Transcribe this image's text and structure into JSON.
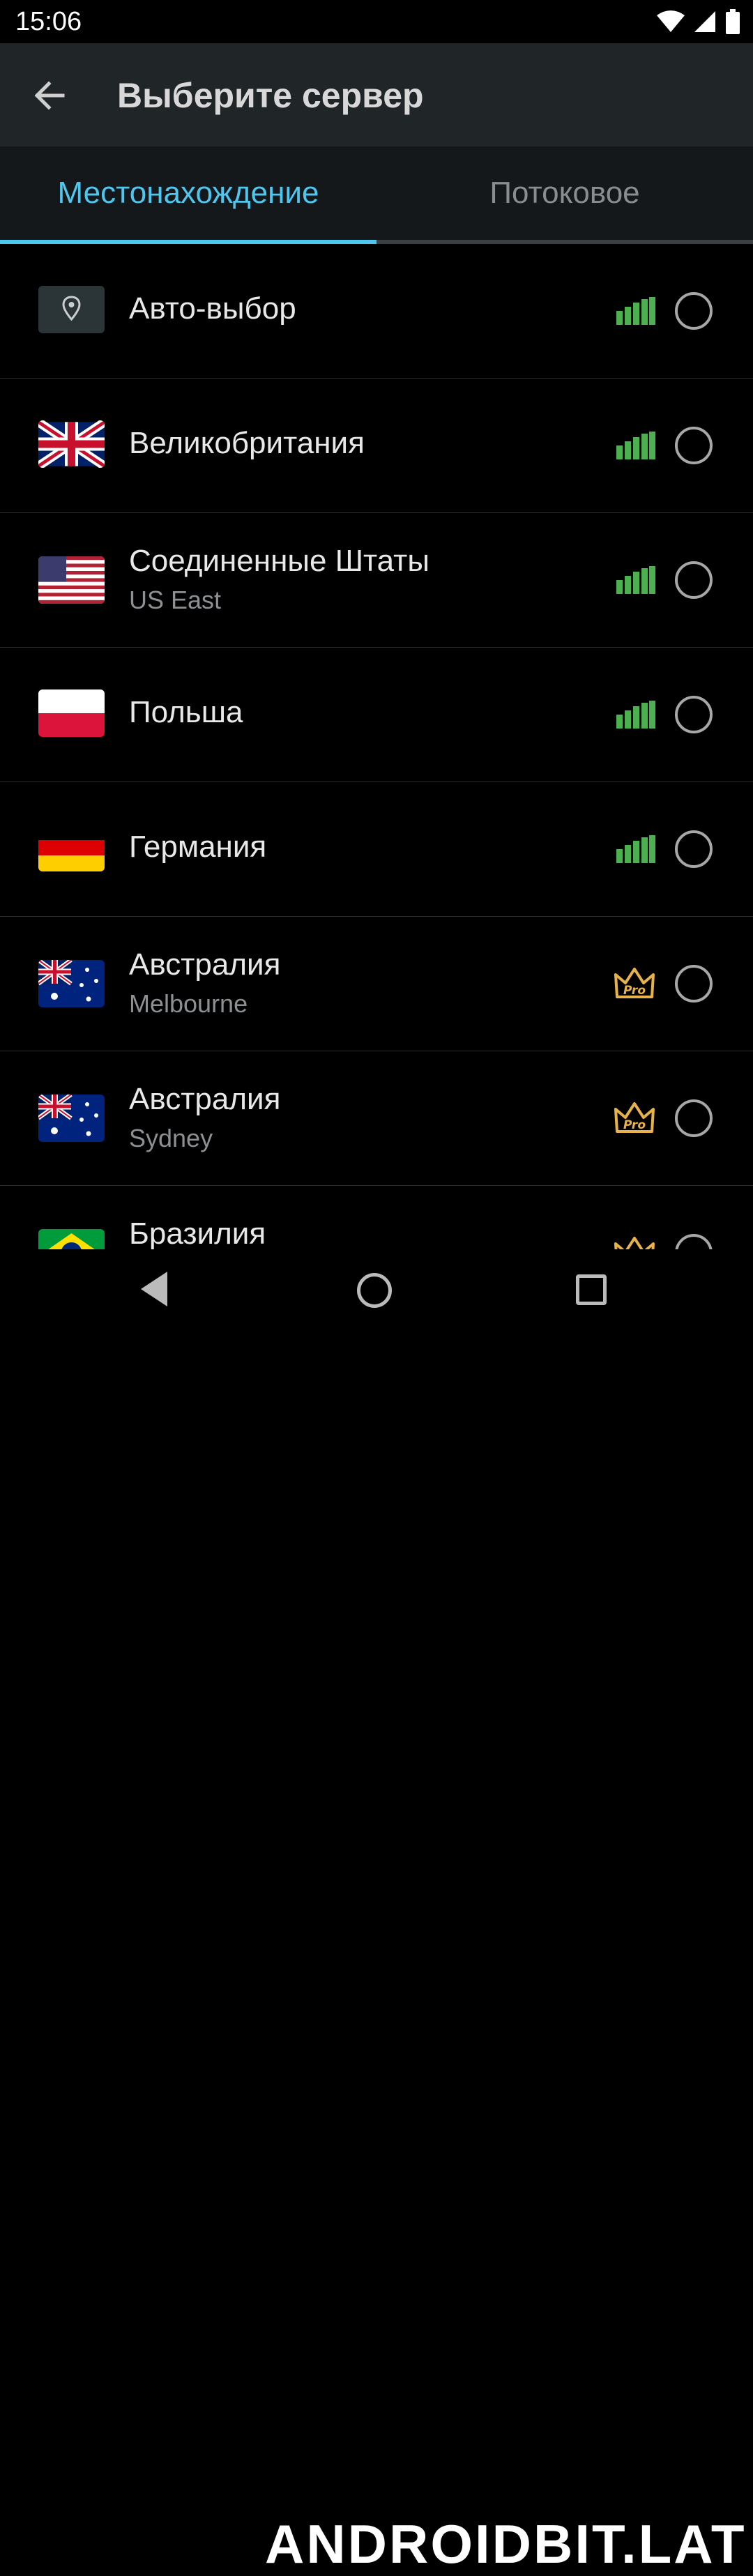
{
  "status_bar": {
    "time": "15:06"
  },
  "app_bar": {
    "title": "Выберите сервер"
  },
  "tabs": [
    {
      "label": "Местонахождение",
      "active": true
    },
    {
      "label": "Потоковое",
      "active": false
    }
  ],
  "servers": [
    {
      "name": "Авто-выбор",
      "sub": "",
      "icon": "location-icon",
      "tier": "free"
    },
    {
      "name": "Великобритания",
      "sub": "",
      "icon": "uk-flag-icon",
      "tier": "free"
    },
    {
      "name": "Соединенные Штаты",
      "sub": "US East",
      "icon": "us-flag-icon",
      "tier": "free"
    },
    {
      "name": "Польша",
      "sub": "",
      "icon": "poland-flag-icon",
      "tier": "free"
    },
    {
      "name": "Германия",
      "sub": "",
      "icon": "germany-flag-icon",
      "tier": "free"
    },
    {
      "name": "Австралия",
      "sub": "Melbourne",
      "icon": "australia-flag-icon",
      "tier": "pro"
    },
    {
      "name": "Австралия",
      "sub": "Sydney",
      "icon": "australia-flag-icon",
      "tier": "pro"
    },
    {
      "name": "Бразилия",
      "sub": "",
      "icon": "brazil-flag-icon",
      "tier": "pro"
    }
  ],
  "badges": {
    "pro_label": "Pro"
  },
  "colors": {
    "accent": "#4fc6ee",
    "signal": "#4caf50",
    "pro": "#e8b24a",
    "appbar": "#202528"
  },
  "watermark": "ANDROIDBIT.LAT"
}
